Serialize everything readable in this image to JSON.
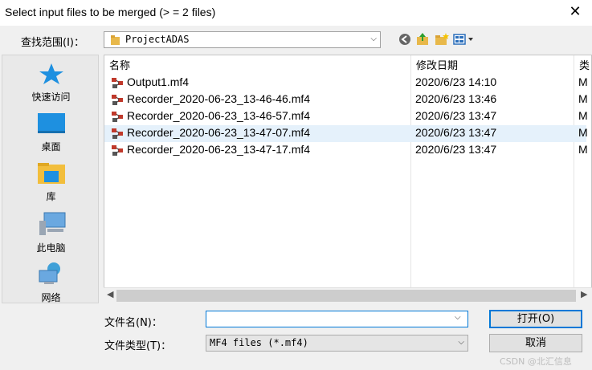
{
  "window": {
    "title": "Select input files to be merged (> = 2 files)"
  },
  "lookin": {
    "label": "查找范围(I)：",
    "value": "ProjectADAS"
  },
  "toolbar": {
    "icons": [
      "back-icon",
      "up-folder-icon",
      "new-folder-icon",
      "view-menu-icon"
    ]
  },
  "places": [
    {
      "label": "快速访问",
      "icon": "star-icon"
    },
    {
      "label": "桌面",
      "icon": "desktop-icon"
    },
    {
      "label": "库",
      "icon": "library-icon"
    },
    {
      "label": "此电脑",
      "icon": "computer-icon"
    },
    {
      "label": "网络",
      "icon": "network-icon"
    }
  ],
  "columns": {
    "name": "名称",
    "date": "修改日期",
    "type": "类"
  },
  "files": [
    {
      "name": "Output1.mf4",
      "date": "2020/6/23 14:10",
      "type": "M"
    },
    {
      "name": "Recorder_2020-06-23_13-46-46.mf4",
      "date": "2020/6/23 13:46",
      "type": "M"
    },
    {
      "name": "Recorder_2020-06-23_13-46-57.mf4",
      "date": "2020/6/23 13:47",
      "type": "M"
    },
    {
      "name": "Recorder_2020-06-23_13-47-07.mf4",
      "date": "2020/6/23 13:47",
      "type": "M"
    },
    {
      "name": "Recorder_2020-06-23_13-47-17.mf4",
      "date": "2020/6/23 13:47",
      "type": "M"
    }
  ],
  "filename": {
    "label": "文件名(N)：",
    "value": ""
  },
  "filetype": {
    "label": "文件类型(T)：",
    "value": "MF4 files (*.mf4)"
  },
  "buttons": {
    "open": "打开(O)",
    "cancel": "取消"
  },
  "watermark": "CSDN @北汇信息"
}
